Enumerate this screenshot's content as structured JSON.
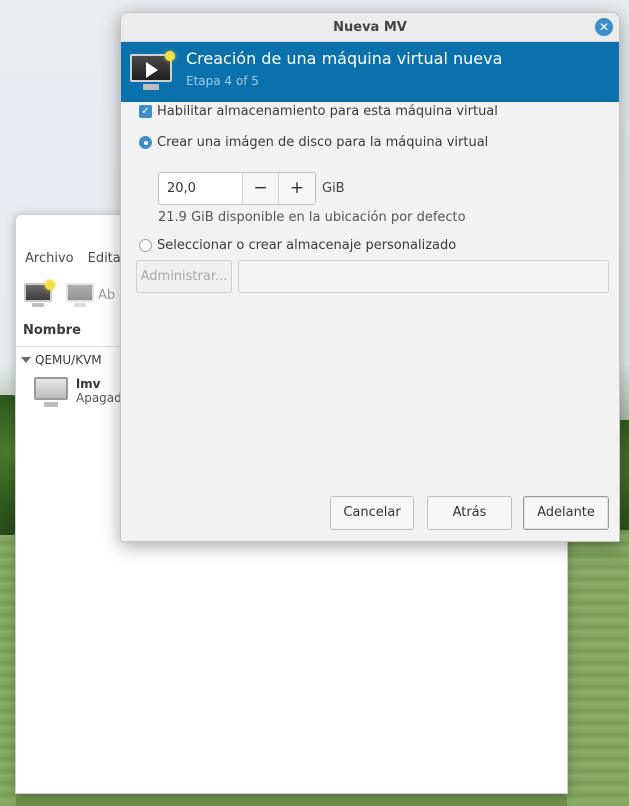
{
  "main_window": {
    "menu": [
      "Archivo",
      "Editar"
    ],
    "toolbar_open_label": "Ab",
    "column_header": "Nombre",
    "group": "QEMU/KVM",
    "vm": {
      "name": "lmv",
      "state": "Apagado"
    }
  },
  "dialog": {
    "title": "Nueva MV",
    "close_icon": "close-icon",
    "banner_title": "Creación de una máquina virtual nueva",
    "banner_step": "Etapa 4 of 5",
    "enable_storage_label": "Habilitar almacenamiento para esta máquina virtual",
    "enable_storage_checked": true,
    "create_disk_label": "Crear una imágen de disco para la máquina virtual",
    "create_disk_selected": true,
    "disk_size": "20,0",
    "minus_label": "−",
    "plus_label": "+",
    "unit": "GiB",
    "available_text": "21.9 GiB disponible en la ubicación por defecto",
    "custom_storage_label": "Seleccionar o crear almacenaje personalizado",
    "custom_storage_selected": false,
    "manage_button": "Administrar...",
    "path_value": "",
    "buttons": {
      "cancel": "Cancelar",
      "back": "Atrás",
      "next": "Adelante"
    }
  },
  "colors": {
    "banner": "#0b71ad",
    "accent": "#3c8fcb"
  }
}
